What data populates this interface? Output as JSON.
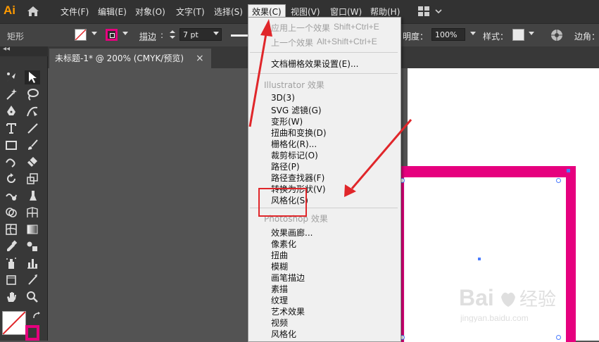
{
  "menubar": {
    "logo": "Ai",
    "items": [
      "文件(F)",
      "编辑(E)",
      "对象(O)",
      "文字(T)",
      "选择(S)",
      "效果(C)",
      "视图(V)",
      "窗口(W)",
      "帮助(H)"
    ],
    "active_index": 5
  },
  "controlbar": {
    "tool_name": "矩形",
    "stroke_label": "描边",
    "stroke_value": "7 pt",
    "opacity_label": "透明度",
    "opacity_label_visible": "明度：",
    "opacity_value": "100%",
    "style_label": "样式：",
    "corner_label": "边角：",
    "fill_color": "#ffffff",
    "stroke_color": "#e6007e"
  },
  "document_tab": {
    "title": "未标题-1* @ 200% (CMYK/预览)",
    "close": "×"
  },
  "effect_menu": {
    "apply_last": "应用上一个效果",
    "apply_last_shortcut": "Shift+Ctrl+E",
    "last_effect": "上一个效果",
    "last_effect_shortcut": "Alt+Shift+Ctrl+E",
    "raster_settings": "文档栅格效果设置(E)...",
    "illustrator_header": "Illustrator 效果",
    "illustrator_items": [
      "3D(3)",
      "SVG 滤镜(G)",
      "变形(W)",
      "扭曲和变换(D)",
      "栅格化(R)...",
      "裁剪标记(O)",
      "路径(P)",
      "路径查找器(F)",
      "转换为形状(V)",
      "风格化(S)"
    ],
    "photoshop_header": "Photoshop 效果",
    "photoshop_items": [
      "效果画廊...",
      "像素化",
      "扭曲",
      "模糊",
      "画笔描边",
      "素描",
      "纹理",
      "艺术效果",
      "视频",
      "风格化"
    ]
  },
  "watermark": {
    "brand": "Bai",
    "brand2": "经验",
    "url": "jingyan.baidu.com"
  },
  "colors": {
    "accent_magenta": "#e6007e",
    "annotation_red": "#e0262a",
    "selection_blue": "#4a7cff"
  }
}
